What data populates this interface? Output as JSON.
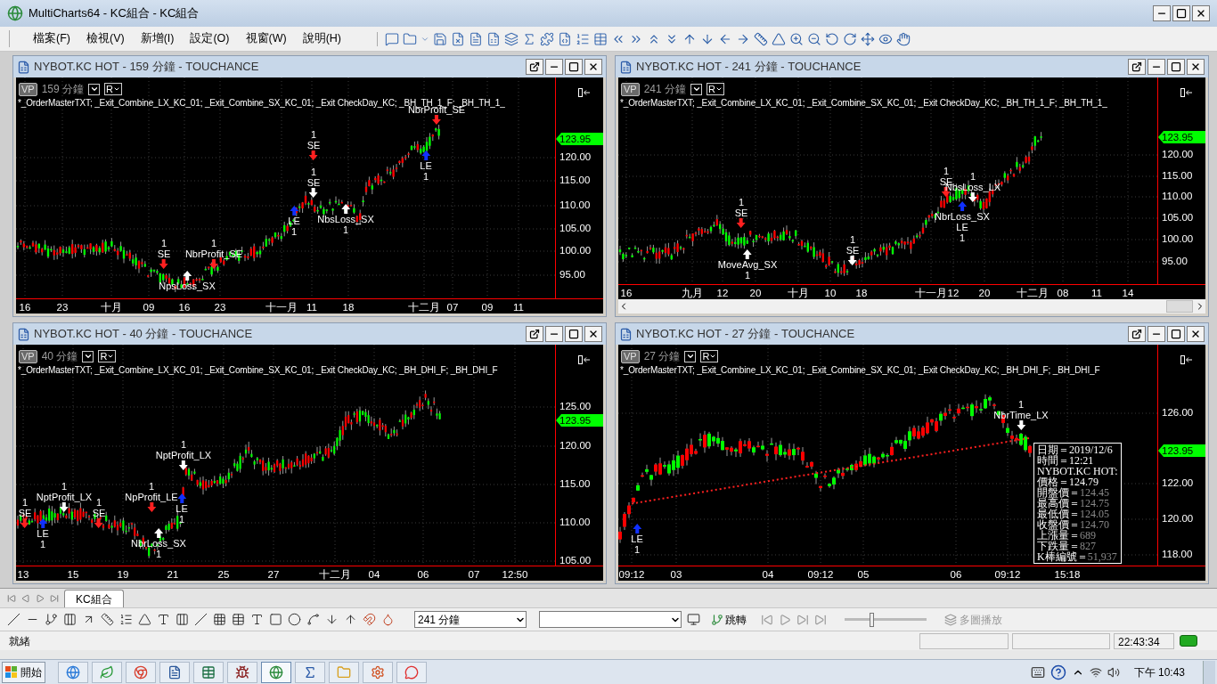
{
  "window": {
    "title": "MultiCharts64 - KC組合 - KC組合"
  },
  "menu": [
    "檔案(F)",
    "檢視(V)",
    "新增(I)",
    "設定(O)",
    "視窗(W)",
    "說明(H)"
  ],
  "charts": [
    {
      "title": "NYBOT.KC HOT - 159 分鐘 - TOUCHANCE",
      "vp": "VP",
      "interval": "159 分鐘",
      "r": "R",
      "studies": "*_OrderMasterTXT; _Exit_Combine_LX_KC_01; _Exit_Combine_SX_KC_01; _Exit CheckDay_KC; _BH_TH_1_F; _BH_TH_1_",
      "price_ticks": [
        "120.00",
        "115.00",
        "110.00",
        "105.00",
        "100.00",
        "95.00"
      ],
      "last_price": "123.95",
      "time_ticks": [
        "16",
        "23",
        "十月",
        "09",
        "16",
        "23",
        "十一月",
        "11",
        "18",
        "十二月",
        "07",
        "09",
        "11"
      ],
      "horizontal_scrollbar": false,
      "markers": [
        {
          "lines": [
            "NbrProfit_SE"
          ],
          "kind": "down",
          "color": "#ff2020"
        },
        {
          "lines": [
            "1",
            "SE"
          ],
          "kind": "down",
          "color": "#ff2020"
        },
        {
          "lines": [
            "1",
            "SE"
          ],
          "kind": "down",
          "color": "#ffffff"
        },
        {
          "lines": [
            "LE",
            "1"
          ],
          "kind": "up",
          "color": "#1030ff"
        },
        {
          "lines": [
            "NbsLoss_SX",
            "1"
          ],
          "kind": "up",
          "color": "#ffffff"
        },
        {
          "lines": [
            "LE",
            "1"
          ],
          "kind": "up",
          "color": "#1030ff"
        },
        {
          "lines": [
            "1",
            "SE"
          ],
          "kind": "down",
          "color": "#ff2020"
        },
        {
          "lines": [
            "1",
            "NbrProfit_SE"
          ],
          "kind": "down",
          "color": "#ff2020"
        },
        {
          "lines": [
            "NpsLoss_SX"
          ],
          "kind": "up",
          "color": "#ffffff"
        }
      ]
    },
    {
      "title": "NYBOT.KC HOT - 241 分鐘 - TOUCHANCE",
      "vp": "VP",
      "interval": "241 分鐘",
      "r": "R",
      "studies": "*_OrderMasterTXT; _Exit_Combine_LX_KC_01; _Exit_Combine_SX_KC_01; _Exit CheckDay_KC; _BH_TH_1_F; _BH_TH_1_",
      "price_ticks": [
        "120.00",
        "115.00",
        "110.00",
        "105.00",
        "100.00",
        "95.00"
      ],
      "last_price": "123.95",
      "time_ticks": [
        "16",
        "九月",
        "12",
        "20",
        "十月",
        "10",
        "18",
        "十一月",
        "12",
        "20",
        "十二月",
        "08",
        "11",
        "14"
      ],
      "horizontal_scrollbar": true,
      "markers": [
        {
          "lines": [
            "1",
            "SE"
          ],
          "kind": "down",
          "color": "#ff2020"
        },
        {
          "lines": [
            "MoveAvg_SX",
            "1"
          ],
          "kind": "up",
          "color": "#ffffff"
        },
        {
          "lines": [
            "1",
            "SE"
          ],
          "kind": "down",
          "color": "#ffffff"
        },
        {
          "lines": [
            "1",
            "SE"
          ],
          "kind": "down",
          "color": "#ff2020"
        },
        {
          "lines": [
            "1",
            "NbsLoss_LX"
          ],
          "kind": "down",
          "color": "#ffffff"
        },
        {
          "lines": [
            "NbrLoss_SX",
            "LE",
            "1"
          ],
          "kind": "up",
          "color": "#1030ff"
        }
      ]
    },
    {
      "title": "NYBOT.KC HOT - 40 分鐘 - TOUCHANCE",
      "vp": "VP",
      "interval": "40 分鐘",
      "r": "R",
      "studies": "*_OrderMasterTXT; _Exit_Combine_LX_KC_01; _Exit_Combine_SX_KC_01; _Exit CheckDay_KC; _BH_DHI_F; _BH_DHI_F",
      "price_ticks": [
        "125.00",
        "120.00",
        "115.00",
        "110.00",
        "105.00"
      ],
      "last_price": "123.95",
      "time_ticks": [
        "13",
        "15",
        "19",
        "21",
        "25",
        "27",
        "十二月",
        "04",
        "06",
        "07",
        "12:50"
      ],
      "horizontal_scrollbar": false,
      "markers": [
        {
          "lines": [
            "1",
            "NptProfit_LX"
          ],
          "kind": "down",
          "color": "#ffffff"
        },
        {
          "lines": [
            "1",
            "SE"
          ],
          "kind": "down",
          "color": "#ff2020"
        },
        {
          "lines": [
            "LE",
            "1"
          ],
          "kind": "up",
          "color": "#1030ff"
        },
        {
          "lines": [
            "1",
            "SE"
          ],
          "kind": "down",
          "color": "#ff2020"
        },
        {
          "lines": [
            "1",
            "NpProfit_LE"
          ],
          "kind": "down",
          "color": "#ff2020"
        },
        {
          "lines": [
            "1",
            "NptProfit_LX"
          ],
          "kind": "down",
          "color": "#ffffff"
        },
        {
          "lines": [
            "LE",
            "1"
          ],
          "kind": "up",
          "color": "#1030ff"
        },
        {
          "lines": [
            "NbrLoss_SX",
            "1"
          ],
          "kind": "up",
          "color": "#ffffff"
        }
      ]
    },
    {
      "title": "NYBOT.KC HOT - 27 分鐘 - TOUCHANCE",
      "vp": "VP",
      "interval": "27 分鐘",
      "r": "R",
      "studies": "*_OrderMasterTXT; _Exit_Combine_LX_KC_01; _Exit_Combine_SX_KC_01; _Exit CheckDay_KC; _BH_DHI_F; _BH_DHI_F",
      "price_ticks": [
        "126.00",
        "122.00",
        "120.00",
        "118.00"
      ],
      "last_price": "123.95",
      "time_ticks": [
        "09:12",
        "03",
        "04",
        "09:12",
        "05",
        "06",
        "09:12",
        "15:18"
      ],
      "horizontal_scrollbar": false,
      "markers": [
        {
          "lines": [
            "1",
            "NbrTime_LX"
          ],
          "kind": "down",
          "color": "#ffffff"
        },
        {
          "lines": [
            "LE",
            "1"
          ],
          "kind": "up",
          "color": "#1030ff"
        }
      ],
      "data_window": [
        {
          "label": "日期＝2019/12/6"
        },
        {
          "label": "時間＝12:21"
        },
        {
          "label": "NYBOT.KC HOT:"
        },
        {
          "label": "價格＝",
          "value": "124.79",
          "dim": false
        },
        {
          "label": "開盤價＝",
          "value": "124.45",
          "dim": true
        },
        {
          "label": "最高價＝",
          "value": "124.75",
          "dim": true
        },
        {
          "label": "最低價＝",
          "value": "124.05",
          "dim": true
        },
        {
          "label": "收盤價＝",
          "value": "124.70",
          "dim": true
        },
        {
          "label": "上漲量＝",
          "value": "689",
          "dim": true
        },
        {
          "label": "下跌量＝",
          "value": "827",
          "dim": true
        },
        {
          "label": "K棒編號＝",
          "value": "51,937",
          "dim": true
        }
      ]
    }
  ],
  "sheet_tabs": [
    {
      "label": "KC組合",
      "selected": true
    }
  ],
  "bottom_toolbar": {
    "interval_select": "241 分鐘",
    "jump_button": "跳轉",
    "playback_slider": {
      "level": 0.3
    },
    "multi_play_button": {
      "label": "多圖播放",
      "disabled": true
    }
  },
  "status_bar": {
    "text": "就緒",
    "time": "22:43:34"
  },
  "taskbar": {
    "start": "開始",
    "clock": "下午 10:43"
  }
}
